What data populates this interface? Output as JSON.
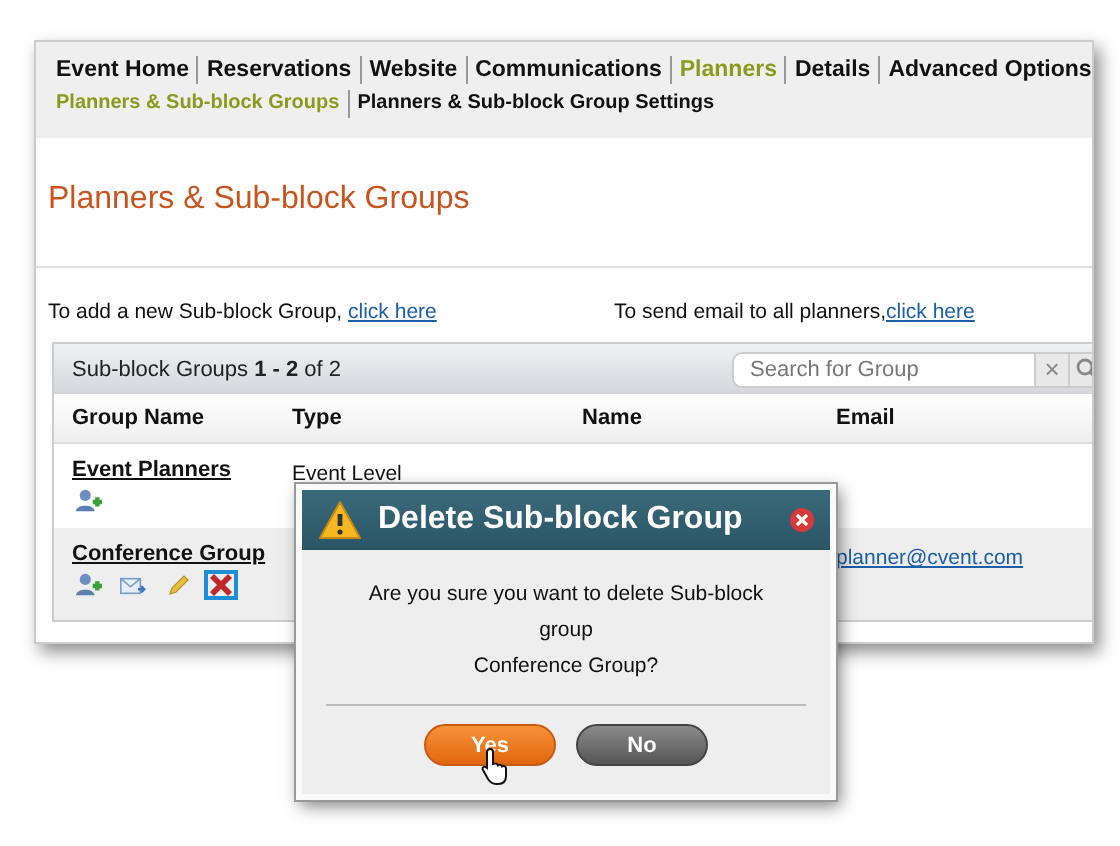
{
  "nav": {
    "primary": [
      {
        "label": "Event Home",
        "selected": false
      },
      {
        "label": "Reservations",
        "selected": false
      },
      {
        "label": "Website",
        "selected": false
      },
      {
        "label": "Communications",
        "selected": false
      },
      {
        "label": "Planners",
        "selected": true
      },
      {
        "label": "Details",
        "selected": false
      },
      {
        "label": "Advanced Options",
        "selected": false
      }
    ],
    "secondary": [
      {
        "label": "Planners & Sub-block Groups",
        "selected": true
      },
      {
        "label": "Planners & Sub-block Group Settings",
        "selected": false
      }
    ]
  },
  "page_title": "Planners & Sub-block Groups",
  "instructions": [
    {
      "text": "To add a new Sub-block Group, ",
      "link": "click here"
    },
    {
      "text": "To send email to all planners,",
      "link": "click here"
    }
  ],
  "table": {
    "summary": "Sub-block Groups **1 - 2** of 2",
    "search": {
      "placeholder": "Search for Group",
      "clear": "×"
    },
    "columns": [
      "Group Name",
      "Type",
      "Name",
      "Email"
    ],
    "rows": [
      {
        "group": "Event Planners",
        "type": "Event Level",
        "email": "",
        "actions": [
          {
            "kind": "add-planner",
            "highlighted": false
          }
        ]
      },
      {
        "group": "Conference Group",
        "type": "",
        "email": "planner@cvent.com",
        "actions": [
          {
            "kind": "add-planner",
            "highlighted": false
          },
          {
            "kind": "email",
            "highlighted": false
          },
          {
            "kind": "edit",
            "highlighted": false
          },
          {
            "kind": "delete",
            "highlighted": true
          }
        ]
      }
    ]
  },
  "dialog": {
    "title": "Delete Sub-block Group",
    "message": [
      "Are you sure you want to delete Sub-block group",
      "Conference Group?"
    ],
    "buttons": [
      {
        "label": "Yes",
        "kind": "primary",
        "hovered": true
      },
      {
        "label": "No",
        "kind": "secondary",
        "hovered": false
      }
    ]
  }
}
